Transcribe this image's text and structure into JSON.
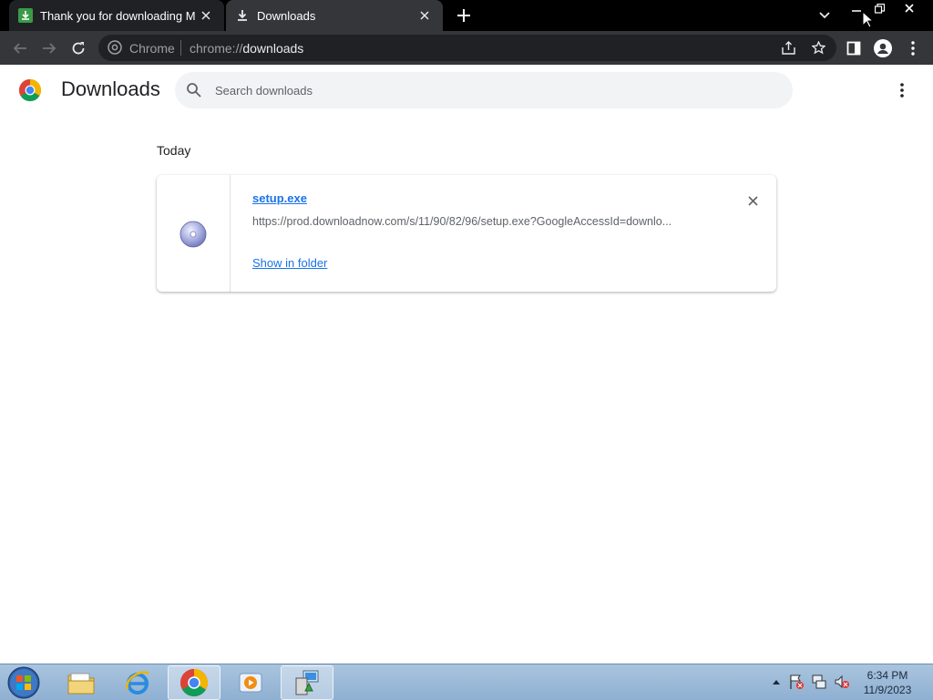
{
  "tabs": [
    {
      "title": "Thank you for downloading Microsoft",
      "icon": "download-site-favicon",
      "active": false
    },
    {
      "title": "Downloads",
      "icon": "download-icon",
      "active": true
    }
  ],
  "omnibox": {
    "site_label": "Chrome",
    "url_prefix": "chrome://",
    "url_host": "downloads"
  },
  "page": {
    "title": "Downloads",
    "search_placeholder": "Search downloads"
  },
  "downloads": {
    "section": "Today",
    "items": [
      {
        "file_name": "setup.exe",
        "url": "https://prod.downloadnow.com/s/11/90/82/96/setup.exe?GoogleAccessId=downlo...",
        "action": "Show in folder",
        "icon": "disc-icon"
      }
    ]
  },
  "taskbar": {
    "apps": [
      "file-explorer",
      "internet-explorer",
      "chrome",
      "media-player",
      "installer"
    ],
    "time": "6:34 PM",
    "date": "11/9/2023"
  },
  "colors": {
    "accent": "#1a73e8",
    "toolbar": "#35363a",
    "tabstrip": "#000000"
  }
}
